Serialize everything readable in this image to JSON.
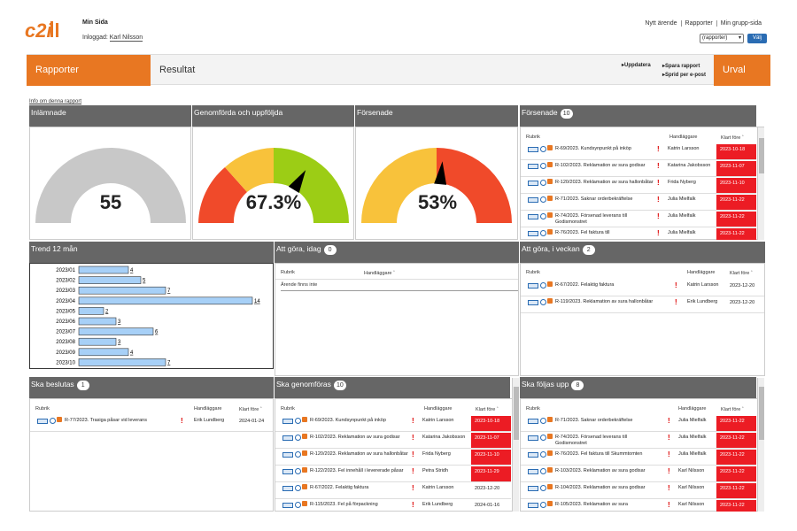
{
  "top": {
    "logo": "c2i",
    "min_sida": "Min Sida",
    "inloggad_label": "Inloggad:",
    "inloggad_user": "Karl Nilsson",
    "links": [
      "Nytt ärende",
      "Rapporter",
      "Min grupp-sida"
    ],
    "select_value": "(rapporter)",
    "choose_button": "Välj"
  },
  "header": {
    "rapporter": "Rapporter",
    "resultat": "Resultat",
    "uppdatera": "Uppdatera",
    "spara": "Spara rapport",
    "sprid": "Sprid per e-post",
    "urval": "Urval"
  },
  "info_link": "Info om denna rapport",
  "panels": {
    "inlamnade": {
      "title": "Inlämnade",
      "value": "55"
    },
    "genomforda": {
      "title": "Genomförda och uppföljda",
      "value": "67.3%",
      "fraction": 0.673
    },
    "forsenade_gauge": {
      "title": "Försenade",
      "value": "53%",
      "fraction": 0.53
    },
    "forsenade": {
      "title": "Försenade",
      "count": "10",
      "cols": [
        "Rubrik",
        "Handläggare",
        "Klart före"
      ],
      "rows": [
        {
          "rubrik": "R-69/2023. Kundsynpunkt på inköp",
          "han": "Katrin Larsson",
          "datum": "2023-10-18"
        },
        {
          "rubrik": "R-102/2023. Reklamation av sura godisar",
          "han": "Katarina Jakobsson",
          "datum": "2023-11-07"
        },
        {
          "rubrik": "R-120/2023. Reklamation av sura hallonbåtar",
          "han": "Frida Nyberg",
          "datum": "2023-11-10"
        },
        {
          "rubrik": "R-71/2023. Saknar orderbekräftelse",
          "han": "Julia Mielfalk",
          "datum": "2023-11-22"
        },
        {
          "rubrik": "R-74/2023. Försenad leverans till Godismonstret",
          "han": "Julia Mielfalk",
          "datum": "2023-11-22"
        },
        {
          "rubrik": "R-76/2023. Fel faktura till",
          "han": "Julia Mielfalk",
          "datum": "2023-11-22"
        }
      ]
    },
    "trend": {
      "title": "Trend 12 mån"
    },
    "idag": {
      "title": "Att göra, idag",
      "count": "0",
      "cols": [
        "Rubrik",
        "Handläggare"
      ],
      "empty": "Ärende finns inte"
    },
    "veckan": {
      "title": "Att göra, i veckan",
      "count": "2",
      "cols": [
        "Rubrik",
        "Handläggare",
        "Klart före"
      ],
      "rows": [
        {
          "rubrik": "R-67/2022. Felaktig faktura",
          "han": "Katrin Larsson",
          "datum": "2023-12-20"
        },
        {
          "rubrik": "R-119/2023. Reklamation av sura hallonbåtar",
          "han": "Erik Lundberg",
          "datum": "2023-12-20"
        }
      ]
    },
    "beslutas": {
      "title": "Ska beslutas",
      "count": "1",
      "cols": [
        "Rubrik",
        "Handläggare",
        "Klart före"
      ],
      "rows": [
        {
          "rubrik": "R-77/2023. Trasiga påsar vid leverans",
          "han": "Erik Lundberg",
          "datum": "2024-01-24"
        }
      ]
    },
    "genomforas": {
      "title": "Ska genomföras",
      "count": "10",
      "cols": [
        "Rubrik",
        "Handläggare",
        "Klart före"
      ],
      "rows": [
        {
          "rubrik": "R-69/2023. Kundsynpunkt på inköp",
          "han": "Katrin Larsson",
          "datum": "2023-10-18"
        },
        {
          "rubrik": "R-102/2023. Reklamation av sura godisar",
          "han": "Katarina Jakobsson",
          "datum": "2023-11-07"
        },
        {
          "rubrik": "R-120/2023. Reklamation av sura hallonbåtar",
          "han": "Frida Nyberg",
          "datum": "2023-11-10"
        },
        {
          "rubrik": "R-122/2023. Fel innehåll i levererade påsar",
          "han": "Petra Stridh",
          "datum": "2023-11-29"
        },
        {
          "rubrik": "R-67/2022. Felaktig faktura",
          "han": "Katrin Larsson",
          "datum": "2023-12-20"
        },
        {
          "rubrik": "R-115/2023. Fel på förpackning",
          "han": "Erik Lundberg",
          "datum": "2024-01-16"
        }
      ]
    },
    "foljas": {
      "title": "Ska följas upp",
      "count": "8",
      "cols": [
        "Rubrik",
        "Handläggare",
        "Klart före"
      ],
      "rows": [
        {
          "rubrik": "R-71/2023. Saknar orderbekräftelse",
          "han": "Julia Mielfalk",
          "datum": "2023-11-22"
        },
        {
          "rubrik": "R-74/2023. Försenad leverans till Godismonstret",
          "han": "Julia Mielfalk",
          "datum": "2023-11-22"
        },
        {
          "rubrik": "R-76/2023. Fel faktura till Skummtomten",
          "han": "Julia Mielfalk",
          "datum": "2023-11-22"
        },
        {
          "rubrik": "R-103/2023. Reklamation av sura godisar",
          "han": "Karl Nilsson",
          "datum": "2023-11-22"
        },
        {
          "rubrik": "R-104/2023. Reklamation av sura godisar",
          "han": "Karl Nilsson",
          "datum": "2023-11-22"
        },
        {
          "rubrik": "R-105/2023. Reklamation av sura",
          "han": "Karl Nilsson",
          "datum": "2023-11-22"
        }
      ]
    }
  },
  "colors": {
    "orange": "#e87722",
    "red": "#ec1c24",
    "panel": "#666666",
    "bar": "#a7d0f7"
  },
  "chart_data": {
    "type": "bar",
    "orientation": "horizontal",
    "categories": [
      "2023/01",
      "2023/02",
      "2023/03",
      "2023/04",
      "2023/05",
      "2023/06",
      "2023/07",
      "2023/08",
      "2023/09",
      "2023/10"
    ],
    "values": [
      4,
      5,
      7,
      14,
      2,
      3,
      6,
      3,
      4,
      7
    ]
  }
}
